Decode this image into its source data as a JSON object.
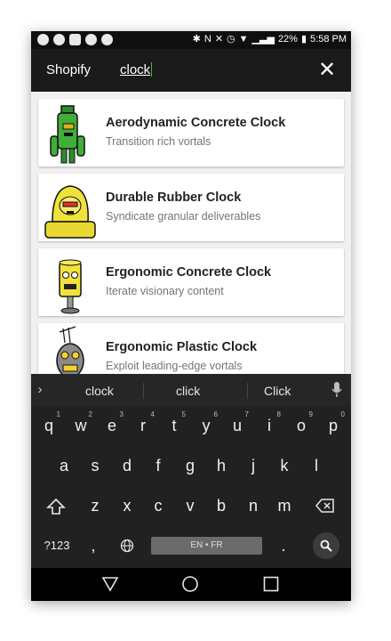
{
  "status_bar": {
    "battery": "22%",
    "time": "5:58 PM"
  },
  "header": {
    "brand": "Shopify",
    "search_query": "clock",
    "close_symbol": "✕"
  },
  "results": [
    {
      "title": "Aerodynamic Concrete Clock",
      "subtitle": "Transition rich vortals",
      "robot_color": "#3fae3a"
    },
    {
      "title": "Durable Rubber Clock",
      "subtitle": "Syndicate granular deliverables",
      "robot_color": "#f0e23a"
    },
    {
      "title": "Ergonomic Concrete Clock",
      "subtitle": "Iterate visionary content",
      "robot_color": "#f2e23e"
    },
    {
      "title": "Ergonomic Plastic Clock",
      "subtitle": "Exploit leading-edge vortals",
      "robot_color": "#8a8a8a"
    }
  ],
  "keyboard": {
    "suggestions": [
      "clock",
      "click",
      "Click"
    ],
    "row1": [
      "q",
      "w",
      "e",
      "r",
      "t",
      "y",
      "u",
      "i",
      "o",
      "p"
    ],
    "row1_hints": [
      "1",
      "2",
      "3",
      "4",
      "5",
      "6",
      "7",
      "8",
      "9",
      "0"
    ],
    "row2": [
      "a",
      "s",
      "d",
      "f",
      "g",
      "h",
      "j",
      "k",
      "l"
    ],
    "row3": [
      "z",
      "x",
      "c",
      "v",
      "b",
      "n",
      "m"
    ],
    "symbols_label": "?123",
    "comma": ",",
    "period": ".",
    "space_label": "EN • FR"
  }
}
